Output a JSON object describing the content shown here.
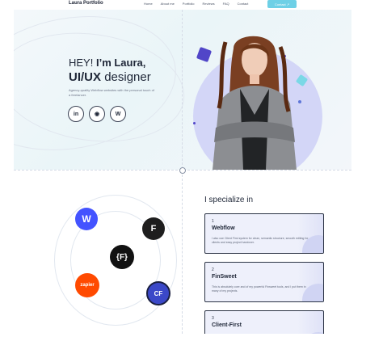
{
  "nav": {
    "brand": "Laura Portfolio",
    "links": [
      "Home",
      "About me",
      "Portfolio",
      "Reviews",
      "FAQ",
      "Contact"
    ],
    "contact_button": "Contact ↗"
  },
  "hero": {
    "greeting": "HEY!",
    "intro": "I’m Laura,",
    "role_bold": "UI/UX",
    "role_rest": "designer",
    "description": "Agency-quality Webflow websites with the personal touch of a freelancer.",
    "socials": [
      {
        "icon": "linkedin-icon",
        "glyph": "in"
      },
      {
        "icon": "dribbble-icon",
        "glyph": "◉"
      },
      {
        "icon": "webflow-icon",
        "glyph": "W"
      }
    ]
  },
  "tools": [
    {
      "name": "webflow-logo",
      "glyph": "W",
      "color": "#4353ff"
    },
    {
      "name": "figma-logo",
      "glyph": "F",
      "color": "#1e1e1e"
    },
    {
      "name": "finsweet-logo",
      "glyph": "{F}",
      "color": "#111111"
    },
    {
      "name": "zapier-logo",
      "glyph": "zapier",
      "color": "#ff4a00"
    },
    {
      "name": "client-first-logo",
      "glyph": "CF",
      "color": "#3b48c8"
    }
  ],
  "specialize": {
    "title": "I specialize in",
    "cards": [
      {
        "num": "1",
        "title": "Webflow",
        "desc": "I also use Client First system for clean, semantic structure, smooth editing for clients and easy project handover."
      },
      {
        "num": "2",
        "title": "FinSweet",
        "desc": "This is absolutely core and of my powerful Finsweet tools, and I put them in many of my projects."
      },
      {
        "num": "3",
        "title": "Client-First",
        "desc": ""
      }
    ]
  },
  "colors": {
    "accent": "#6ed0e6",
    "disc": "#d3d6f7",
    "deco_purple": "#5146c8",
    "deco_cyan": "#7ad8e6"
  }
}
